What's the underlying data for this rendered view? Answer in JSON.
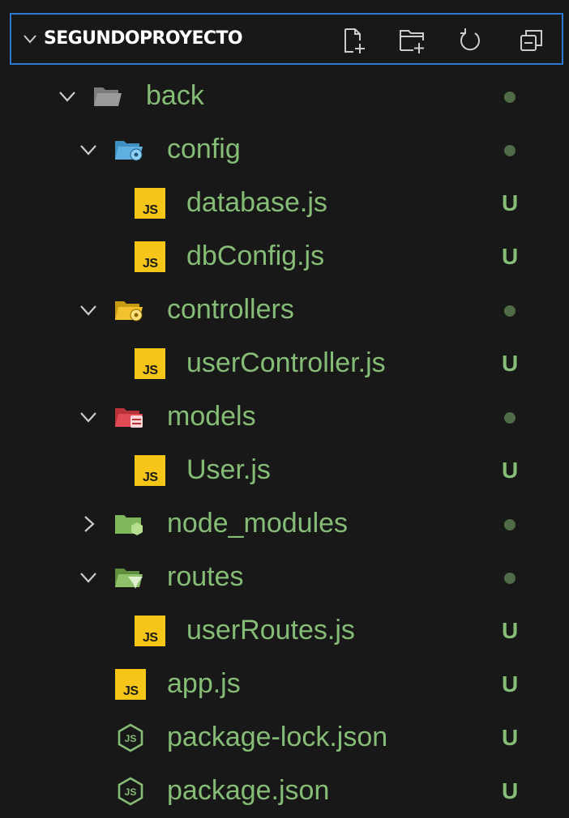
{
  "explorer": {
    "title": "SEGUNDOPROYECTO",
    "actions": [
      "new-file",
      "new-folder",
      "refresh",
      "collapse-all"
    ]
  },
  "tree": {
    "back": {
      "label": "back",
      "status": "dot"
    },
    "config": {
      "label": "config",
      "status": "dot"
    },
    "database_js": {
      "label": "database.js",
      "status": "U"
    },
    "dbConfig_js": {
      "label": "dbConfig.js",
      "status": "U"
    },
    "controllers": {
      "label": "controllers",
      "status": "dot"
    },
    "userController_js": {
      "label": "userController.js",
      "status": "U"
    },
    "models": {
      "label": "models",
      "status": "dot"
    },
    "User_js": {
      "label": "User.js",
      "status": "U"
    },
    "node_modules": {
      "label": "node_modules",
      "status": "dot"
    },
    "routes": {
      "label": "routes",
      "status": "dot"
    },
    "userRoutes_js": {
      "label": "userRoutes.js",
      "status": "U"
    },
    "app_js": {
      "label": "app.js",
      "status": "U"
    },
    "package_lock_json": {
      "label": "package-lock.json",
      "status": "U"
    },
    "package_json": {
      "label": "package.json",
      "status": "U"
    }
  },
  "icons": {
    "js_text": "JS",
    "json_text": "JS"
  },
  "colors": {
    "background": "#181818",
    "focus_border": "#2b79d0",
    "untracked_green": "#86bd76",
    "js_yellow": "#f5c518"
  }
}
